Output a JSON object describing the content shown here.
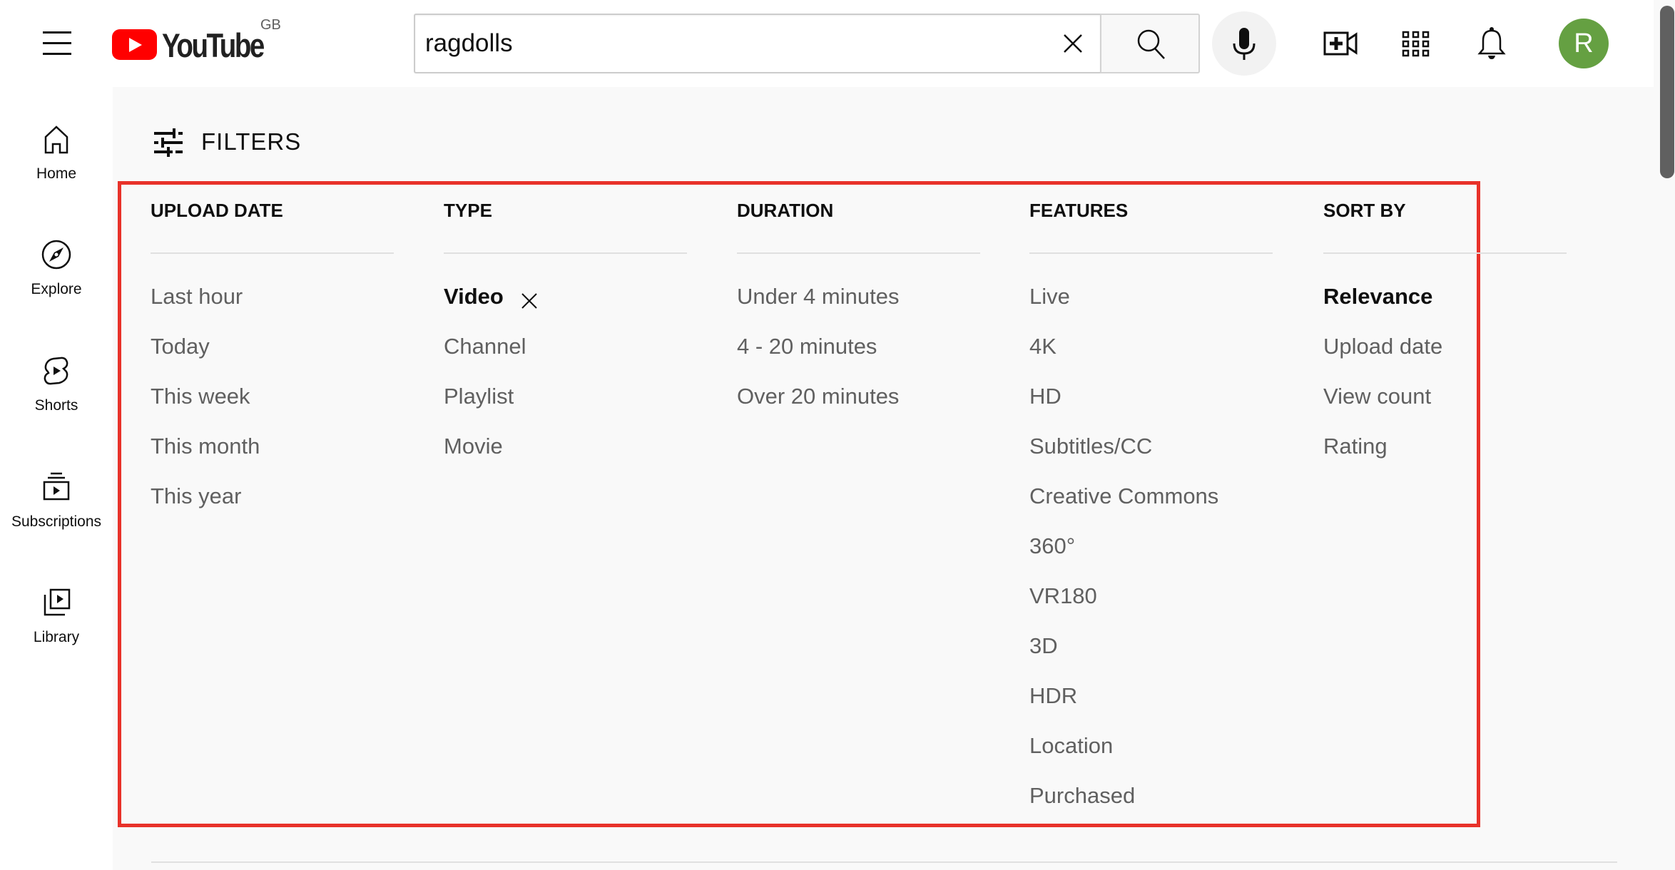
{
  "header": {
    "menu_icon": "hamburger-menu-icon",
    "logo_text": "YouTube",
    "logo_region": "GB",
    "search": {
      "value": "ragdolls",
      "placeholder": "Search"
    },
    "icons": [
      "clear-icon",
      "search-icon",
      "mic-icon",
      "create-video-icon",
      "apps-grid-icon",
      "bell-icon"
    ],
    "avatar_initial": "R",
    "avatar_color": "#65a042"
  },
  "sidebar": {
    "items": [
      {
        "label": "Home",
        "icon": "home-icon"
      },
      {
        "label": "Explore",
        "icon": "compass-icon"
      },
      {
        "label": "Shorts",
        "icon": "shorts-icon"
      },
      {
        "label": "Subscriptions",
        "icon": "subscriptions-icon"
      },
      {
        "label": "Library",
        "icon": "library-icon"
      }
    ]
  },
  "filters": {
    "toggle_label": "FILTERS",
    "highlight_color": "#e8322a",
    "groups": [
      {
        "title": "UPLOAD DATE",
        "options": [
          {
            "label": "Last hour",
            "selected": false
          },
          {
            "label": "Today",
            "selected": false
          },
          {
            "label": "This week",
            "selected": false
          },
          {
            "label": "This month",
            "selected": false
          },
          {
            "label": "This year",
            "selected": false
          }
        ]
      },
      {
        "title": "TYPE",
        "options": [
          {
            "label": "Video",
            "selected": true,
            "removable": true
          },
          {
            "label": "Channel",
            "selected": false
          },
          {
            "label": "Playlist",
            "selected": false
          },
          {
            "label": "Movie",
            "selected": false
          }
        ]
      },
      {
        "title": "DURATION",
        "options": [
          {
            "label": "Under 4 minutes",
            "selected": false
          },
          {
            "label": "4 - 20 minutes",
            "selected": false
          },
          {
            "label": "Over 20 minutes",
            "selected": false
          }
        ]
      },
      {
        "title": "FEATURES",
        "options": [
          {
            "label": "Live",
            "selected": false
          },
          {
            "label": "4K",
            "selected": false
          },
          {
            "label": "HD",
            "selected": false
          },
          {
            "label": "Subtitles/CC",
            "selected": false
          },
          {
            "label": "Creative Commons",
            "selected": false
          },
          {
            "label": "360°",
            "selected": false
          },
          {
            "label": "VR180",
            "selected": false
          },
          {
            "label": "3D",
            "selected": false
          },
          {
            "label": "HDR",
            "selected": false
          },
          {
            "label": "Location",
            "selected": false
          },
          {
            "label": "Purchased",
            "selected": false
          }
        ]
      },
      {
        "title": "SORT BY",
        "options": [
          {
            "label": "Relevance",
            "selected": true
          },
          {
            "label": "Upload date",
            "selected": false
          },
          {
            "label": "View count",
            "selected": false
          },
          {
            "label": "Rating",
            "selected": false
          }
        ]
      }
    ]
  }
}
